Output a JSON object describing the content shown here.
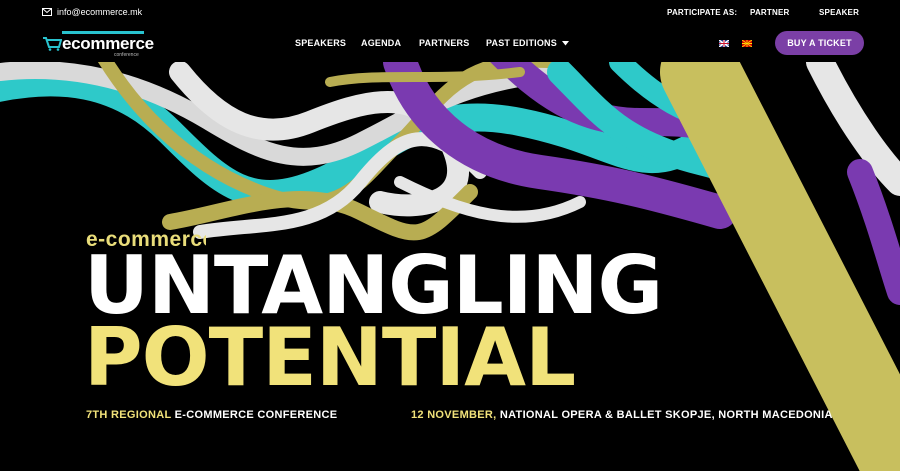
{
  "topbar": {
    "email": "info@ecommerce.mk",
    "participate_label": "PARTICIPATE AS:",
    "partner_label": "PARTNER",
    "speaker_label": "SPEAKER"
  },
  "logo": {
    "word": "ecommerce",
    "sub": "conference"
  },
  "nav": {
    "items": [
      "SPEAKERS",
      "AGENDA",
      "PARTNERS",
      "PAST EDITIONS"
    ],
    "buy_label": "BUY A TICKET"
  },
  "hero": {
    "kicker": "e-commerce",
    "headline_line1": "UNTANGLING",
    "headline_line2": "POTENTIAL",
    "edition_highlight": "7TH REGIONAL",
    "edition_rest": "E-COMMERCE CONFERENCE",
    "date_highlight": "12 NOVEMBER,",
    "venue": "NATIONAL OPERA & BALLET SKOPJE, NORTH MACEDONIA"
  },
  "colors": {
    "accent_yellow": "#f1e27a",
    "button_purple": "#7b3fa6",
    "logo_teal": "#29c3cf",
    "ribbon_purple": "#7a3ab0",
    "ribbon_teal": "#2ec9c9",
    "ribbon_olive": "#b8ad52",
    "ribbon_white": "#e6e6e6"
  },
  "icons": {
    "email": "envelope-icon",
    "cart": "cart-icon",
    "dropdown": "chevron-down-icon"
  }
}
